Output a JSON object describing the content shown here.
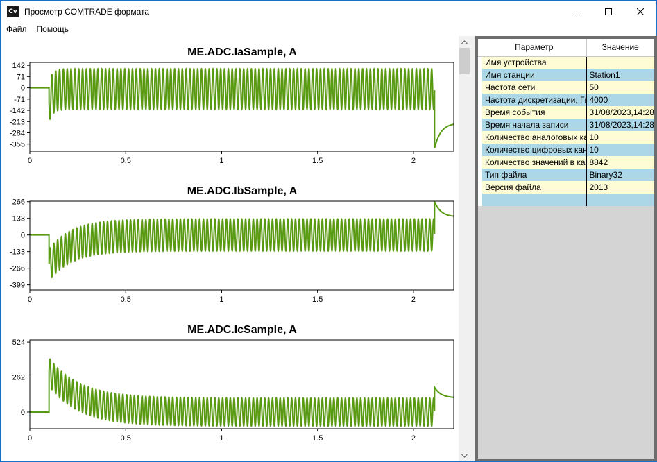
{
  "window": {
    "icon_text": "Cv",
    "title": "Просмотр COMTRADE формата",
    "accent": "#1c6fc9"
  },
  "menu": [
    {
      "label": "Файл"
    },
    {
      "label": "Помощь"
    }
  ],
  "charts": [
    {
      "title": "ME.ADC.IaSample, A",
      "type": "line",
      "color": "#5a9a12",
      "yticks": [
        "142",
        "71",
        "0",
        "-71",
        "-142",
        "-213",
        "-284",
        "-355"
      ],
      "ytick_values": [
        142,
        71,
        0,
        -71,
        -142,
        -213,
        -284,
        -355
      ],
      "ylim": [
        -400,
        160
      ],
      "xticks": [
        "0",
        "0.5",
        "1",
        "1.5",
        "2"
      ],
      "xtick_values": [
        0,
        0.5,
        1,
        1.5,
        2
      ],
      "xlim": [
        0,
        2.21
      ],
      "signal": {
        "pre_until": 0.1,
        "steady_amplitude": 128,
        "dc_offset": -8,
        "fault_end": 2.11,
        "initial_spike": -215,
        "decay_tau": 0.02,
        "post_start": -380,
        "post_end": -230
      }
    },
    {
      "title": "ME.ADC.IbSample, A",
      "type": "line",
      "color": "#5a9a12",
      "yticks": [
        "266",
        "133",
        "0",
        "-133",
        "-266",
        "-399"
      ],
      "ytick_values": [
        266,
        133,
        0,
        -133,
        -266,
        -399
      ],
      "ylim": [
        -440,
        270
      ],
      "xticks": [
        "0",
        "0.5",
        "1",
        "1.5",
        "2"
      ],
      "xtick_values": [
        0,
        0.5,
        1,
        1.5,
        2
      ],
      "xlim": [
        0,
        2.21
      ],
      "signal": {
        "pre_until": 0.1,
        "steady_amplitude": 128,
        "dc_offset": 0,
        "fault_end": 2.11,
        "initial_dc": -240,
        "decay_tau": 0.12,
        "post_start": 266,
        "post_end": 150
      }
    },
    {
      "title": "ME.ADC.IcSample, A",
      "type": "line",
      "color": "#5a9a12",
      "yticks": [
        "524",
        "262",
        "0"
      ],
      "ytick_values": [
        524,
        262,
        0
      ],
      "ylim": [
        -125,
        540
      ],
      "xticks": [
        "0",
        "0.5",
        "1",
        "1.5",
        "2"
      ],
      "xtick_values": [
        0,
        0.5,
        1,
        1.5,
        2
      ],
      "xlim": [
        0,
        2.21
      ],
      "signal": {
        "pre_until": 0.1,
        "steady_amplitude": 105,
        "dc_offset": 0,
        "fault_end": 2.11,
        "initial_dc": 300,
        "decay_tau": 0.16,
        "post_start": 185,
        "post_end": 110
      }
    }
  ],
  "grid": {
    "headers": [
      "Параметр",
      "Значение"
    ],
    "rows": [
      {
        "param": "Имя устройства",
        "value": ""
      },
      {
        "param": "Имя станции",
        "value": "Station1"
      },
      {
        "param": "Частота сети",
        "value": "50"
      },
      {
        "param": "Частота дискретизации, Гц",
        "value": "4000"
      },
      {
        "param": "Время события",
        "value": "31/08/2023,14:28"
      },
      {
        "param": "Время начала записи",
        "value": "31/08/2023,14:28"
      },
      {
        "param": "Количество аналоговых каналов",
        "value": "10"
      },
      {
        "param": "Количество цифровых каналов",
        "value": "10"
      },
      {
        "param": "Количество значений в канале",
        "value": "8842"
      },
      {
        "param": "Тип файла",
        "value": "Binary32"
      },
      {
        "param": "Версия файла",
        "value": "2013"
      },
      {
        "param": "",
        "value": ""
      }
    ]
  }
}
